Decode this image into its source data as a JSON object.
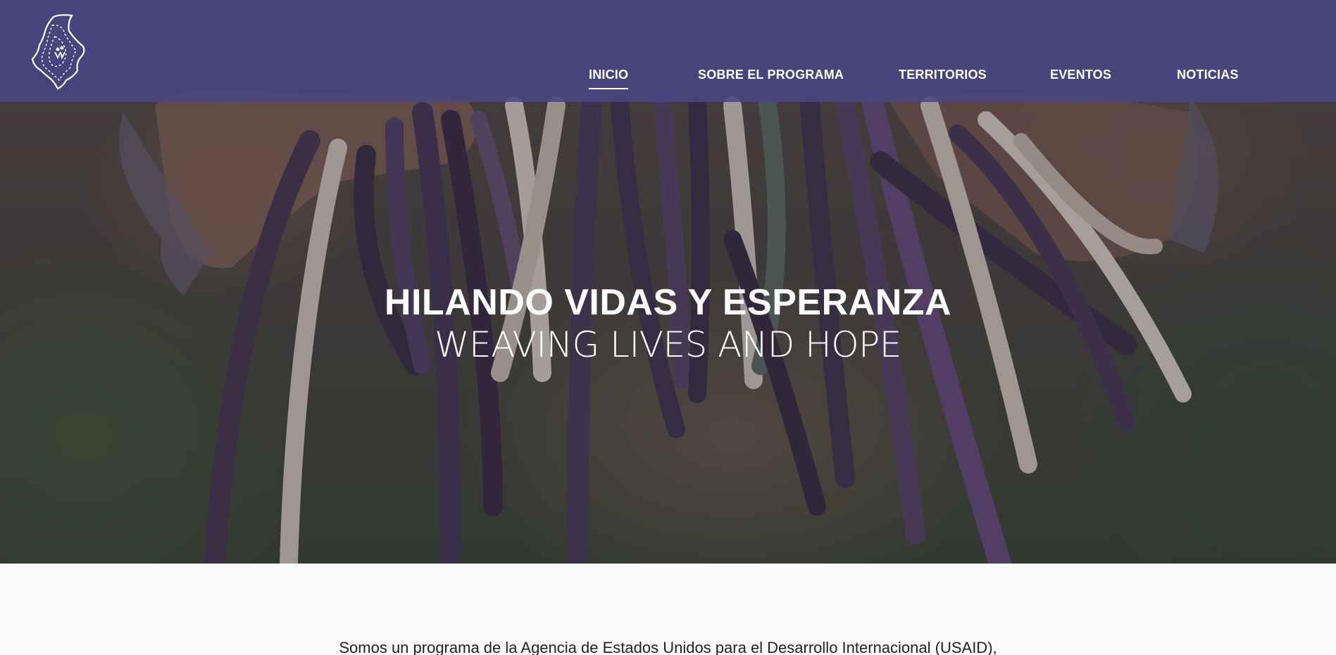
{
  "header": {
    "logo_icon": "colombia-map-logo-icon",
    "nav": [
      {
        "label": "INICIO",
        "active": true
      },
      {
        "label": "SOBRE EL PROGRAMA",
        "active": false
      },
      {
        "label": "TERRITORIOS",
        "active": false
      },
      {
        "label": "EVENTOS",
        "active": false
      },
      {
        "label": "NOTICIAS",
        "active": false
      }
    ]
  },
  "hero": {
    "title": "HILANDO VIDAS Y ESPERANZA",
    "subtitle": "WEAVING LIVES AND HOPE",
    "image": "hands-holding-bean-pods"
  },
  "intro": {
    "text": "Somos un programa de la Agencia de Estados Unidos para el Desarrollo Internacional (USAID),"
  },
  "colors": {
    "header_bg": "#484687",
    "text_light": "#ffffff",
    "body_bg": "#fafafa",
    "body_text": "#222222"
  }
}
